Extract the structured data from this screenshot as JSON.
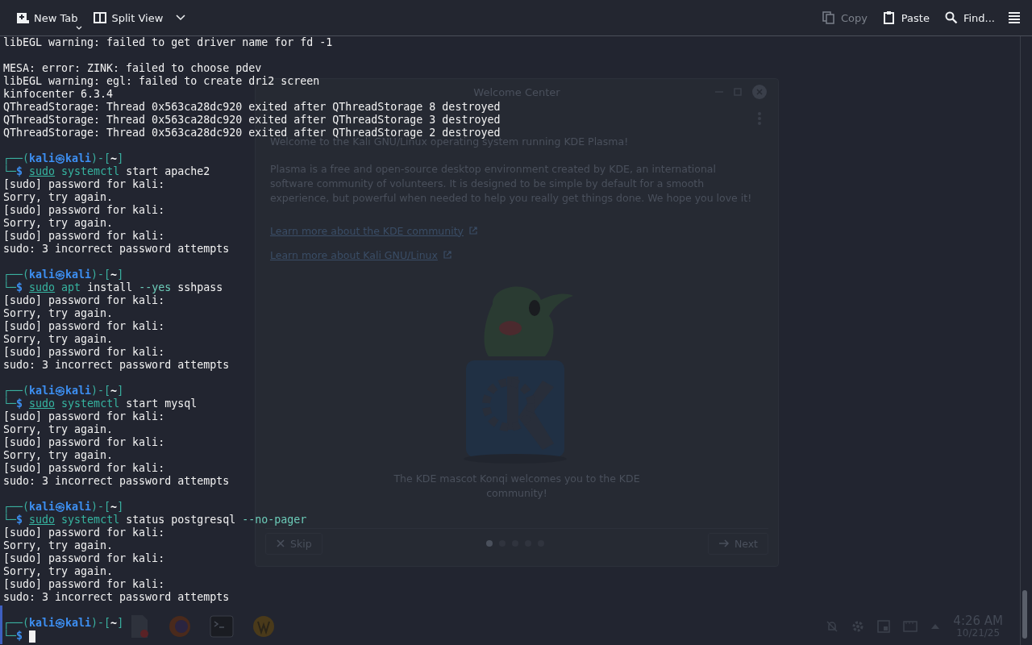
{
  "toolbar": {
    "left": [
      {
        "kind": "new_tab",
        "label": "New Tab",
        "menu_caret": true,
        "dropdown_button": false
      },
      {
        "kind": "split_view",
        "label": "Split View",
        "menu_caret": false,
        "dropdown_button": true
      }
    ],
    "right": [
      {
        "kind": "copy",
        "label": "Copy",
        "disabled": true
      },
      {
        "kind": "paste",
        "label": "Paste",
        "disabled": false
      },
      {
        "kind": "find",
        "label": "Find...",
        "disabled": false
      }
    ]
  },
  "terminal": {
    "lines": [
      {
        "kind": "output",
        "text": "libEGL warning: failed to get driver name for fd -1"
      },
      {
        "kind": "blank"
      },
      {
        "kind": "output",
        "text": "MESA: error: ZINK: failed to choose pdev"
      },
      {
        "kind": "output",
        "text": "libEGL warning: egl: failed to create dri2 screen"
      },
      {
        "kind": "output",
        "text": "kinfocenter 6.3.4"
      },
      {
        "kind": "output",
        "text": "QThreadStorage: Thread 0x563ca28dc920 exited after QThreadStorage 8 destroyed"
      },
      {
        "kind": "output",
        "text": "QThreadStorage: Thread 0x563ca28dc920 exited after QThreadStorage 3 destroyed"
      },
      {
        "kind": "output",
        "text": "QThreadStorage: Thread 0x563ca28dc920 exited after QThreadStorage 2 destroyed"
      },
      {
        "kind": "blank"
      },
      {
        "kind": "prompt",
        "open": "┌──(",
        "user": "kali",
        "at": "㉿",
        "host": "kali",
        "mid": ")-[",
        "dir": "~",
        "close": "]",
        "corner": "└─",
        "symbol": "$",
        "cursor": false,
        "command": [
          {
            "kind": "sudo",
            "text": "sudo"
          },
          {
            "kind": "program",
            "text": "systemctl"
          },
          {
            "kind": "arg",
            "text": "start apache2"
          }
        ]
      },
      {
        "kind": "output",
        "text": "[sudo] password for kali:"
      },
      {
        "kind": "output",
        "text": "Sorry, try again."
      },
      {
        "kind": "output",
        "text": "[sudo] password for kali:"
      },
      {
        "kind": "output",
        "text": "Sorry, try again."
      },
      {
        "kind": "output",
        "text": "[sudo] password for kali:"
      },
      {
        "kind": "output",
        "text": "sudo: 3 incorrect password attempts"
      },
      {
        "kind": "blank"
      },
      {
        "kind": "prompt",
        "open": "┌──(",
        "user": "kali",
        "at": "㉿",
        "host": "kali",
        "mid": ")-[",
        "dir": "~",
        "close": "]",
        "corner": "└─",
        "symbol": "$",
        "cursor": false,
        "command": [
          {
            "kind": "sudo",
            "text": "sudo"
          },
          {
            "kind": "program",
            "text": "apt"
          },
          {
            "kind": "arg",
            "text": "install"
          },
          {
            "kind": "option",
            "text": "--yes"
          },
          {
            "kind": "arg",
            "text": "sshpass"
          }
        ]
      },
      {
        "kind": "output",
        "text": "[sudo] password for kali:"
      },
      {
        "kind": "output",
        "text": "Sorry, try again."
      },
      {
        "kind": "output",
        "text": "[sudo] password for kali:"
      },
      {
        "kind": "output",
        "text": "Sorry, try again."
      },
      {
        "kind": "output",
        "text": "[sudo] password for kali:"
      },
      {
        "kind": "output",
        "text": "sudo: 3 incorrect password attempts"
      },
      {
        "kind": "blank"
      },
      {
        "kind": "prompt",
        "open": "┌──(",
        "user": "kali",
        "at": "㉿",
        "host": "kali",
        "mid": ")-[",
        "dir": "~",
        "close": "]",
        "corner": "└─",
        "symbol": "$",
        "cursor": false,
        "command": [
          {
            "kind": "sudo",
            "text": "sudo"
          },
          {
            "kind": "program",
            "text": "systemctl"
          },
          {
            "kind": "arg",
            "text": "start mysql"
          }
        ]
      },
      {
        "kind": "output",
        "text": "[sudo] password for kali:"
      },
      {
        "kind": "output",
        "text": "Sorry, try again."
      },
      {
        "kind": "output",
        "text": "[sudo] password for kali:"
      },
      {
        "kind": "output",
        "text": "Sorry, try again."
      },
      {
        "kind": "output",
        "text": "[sudo] password for kali:"
      },
      {
        "kind": "output",
        "text": "sudo: 3 incorrect password attempts"
      },
      {
        "kind": "blank"
      },
      {
        "kind": "prompt",
        "open": "┌──(",
        "user": "kali",
        "at": "㉿",
        "host": "kali",
        "mid": ")-[",
        "dir": "~",
        "close": "]",
        "corner": "└─",
        "symbol": "$",
        "cursor": false,
        "command": [
          {
            "kind": "sudo",
            "text": "sudo"
          },
          {
            "kind": "program",
            "text": "systemctl"
          },
          {
            "kind": "arg",
            "text": "status postgresql"
          },
          {
            "kind": "option",
            "text": "--no-pager"
          }
        ]
      },
      {
        "kind": "output",
        "text": "[sudo] password for kali:"
      },
      {
        "kind": "output",
        "text": "Sorry, try again."
      },
      {
        "kind": "output",
        "text": "[sudo] password for kali:"
      },
      {
        "kind": "output",
        "text": "Sorry, try again."
      },
      {
        "kind": "output",
        "text": "[sudo] password for kali:"
      },
      {
        "kind": "output",
        "text": "sudo: 3 incorrect password attempts"
      },
      {
        "kind": "blank"
      },
      {
        "kind": "prompt",
        "open": "┌──(",
        "user": "kali",
        "at": "㉿",
        "host": "kali",
        "mid": ")-[",
        "dir": "~",
        "close": "]",
        "corner": "└─",
        "symbol": "$",
        "cursor": true
      }
    ]
  },
  "desktop": {
    "welcome_window": {
      "title": "Welcome Center",
      "intro": "Welcome to the Kali GNU/Linux operating system running KDE Plasma!",
      "body": "Plasma is a free and open-source desktop environment created by KDE, an international software community of volunteers. It is designed to be simple by default for a smooth experience, but powerful when needed to help you really get things done. We hope you love it!",
      "links": [
        "Learn more about the KDE community",
        "Learn more about Kali GNU/Linux"
      ],
      "caption": "The KDE mascot Konqi welcomes you to the KDE community!",
      "skip": "Skip",
      "next": "Next",
      "pages": [
        {
          "selected": true
        },
        {
          "selected": false
        },
        {
          "selected": false
        },
        {
          "selected": false
        },
        {
          "selected": false
        }
      ]
    },
    "taskbar": {
      "time": "4:26 AM",
      "date": "10/21/25"
    }
  }
}
